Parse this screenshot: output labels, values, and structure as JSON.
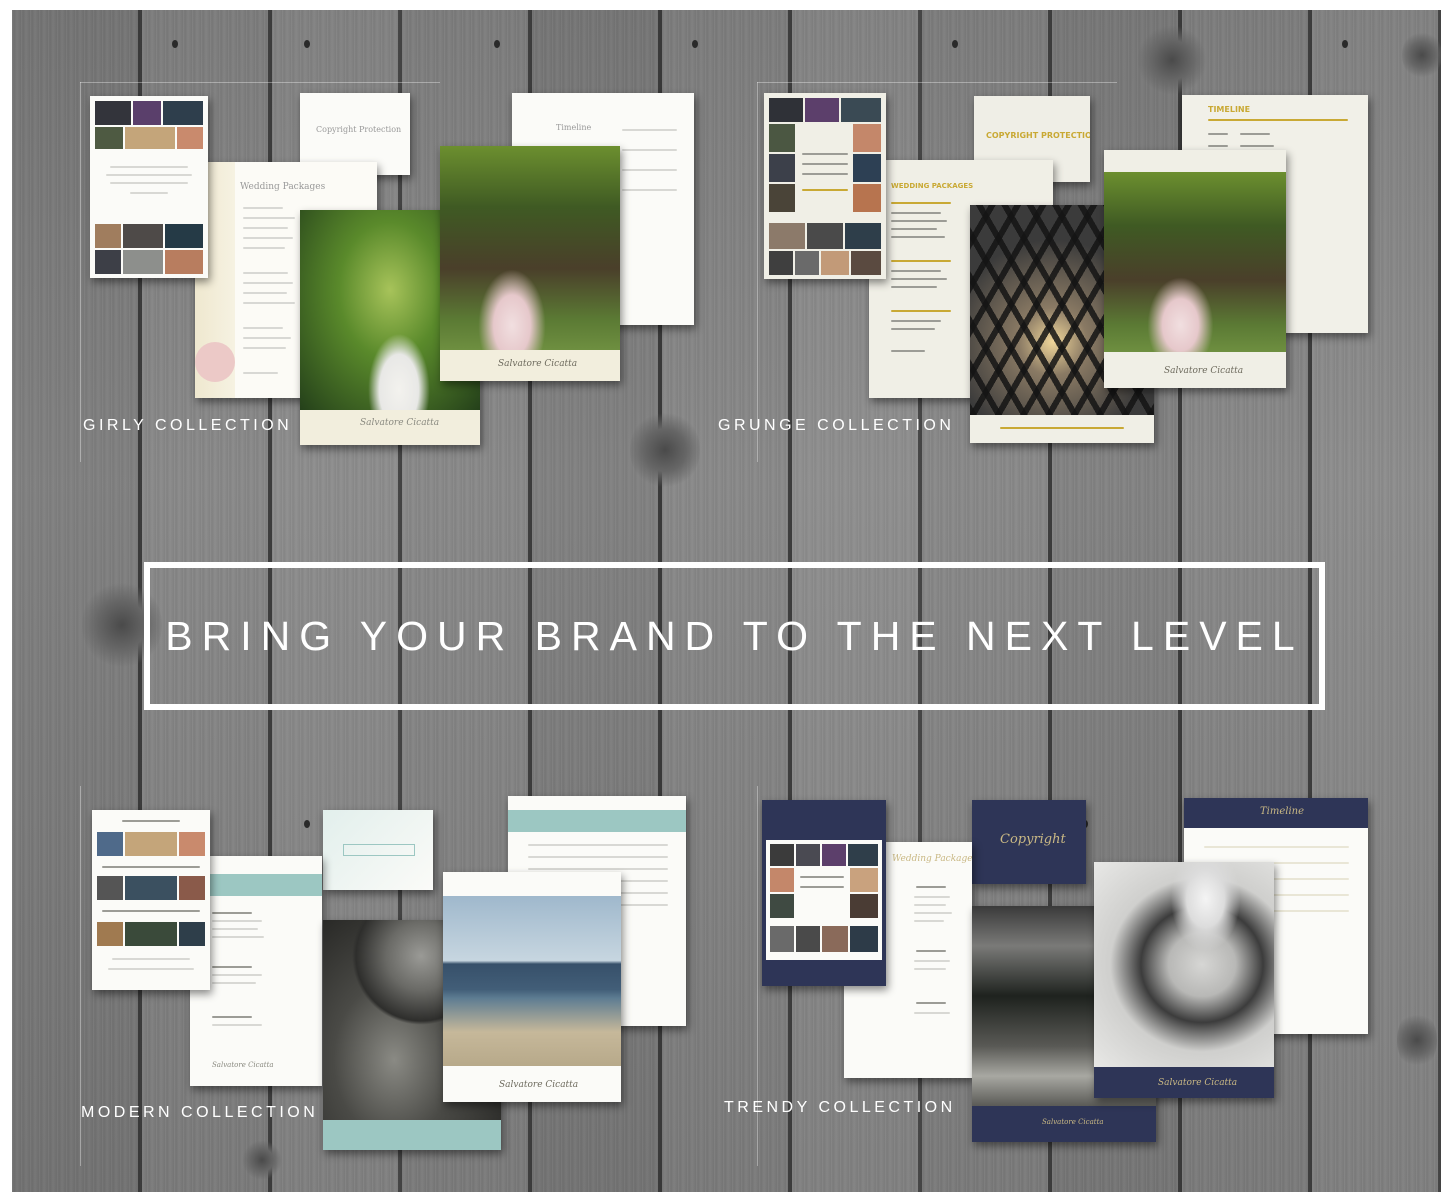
{
  "banner": {
    "text": "BRING YOUR BRAND TO THE NEXT LEVEL"
  },
  "collections": {
    "girly": "GIRLY COLLECTION",
    "grunge": "GRUNGE COLLECTION",
    "modern": "MODERN COLLECTION",
    "trendy": "TRENDY COLLECTION"
  },
  "documents": {
    "girly_copyright": "Copyright Protection",
    "girly_packages": "Wedding Packages",
    "girly_timeline": "Timeline",
    "grunge_copyright": "COPYRIGHT PROTECTION",
    "grunge_timeline": "TIMELINE",
    "grunge_packages": "WEDDING PACKAGES",
    "trendy_copyright": "Copyright",
    "trendy_packages": "Wedding Packages",
    "trendy_timeline": "Timeline",
    "signature": "Salvatore Cicatta"
  },
  "colors": {
    "wood": "#808080",
    "grunge_accent": "#c9a934",
    "modern_accent": "#9cc7c2",
    "trendy_navy": "#2e3557",
    "girly_floral": "#e9e2c8"
  }
}
